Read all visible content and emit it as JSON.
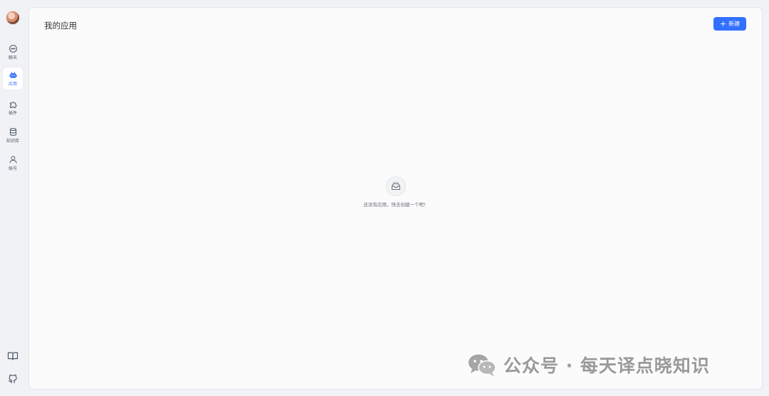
{
  "sidebar": {
    "items": [
      {
        "label": "聊天",
        "icon": "chat-icon"
      },
      {
        "label": "应用",
        "icon": "robot-icon",
        "active": true
      },
      {
        "label": "插件",
        "icon": "puzzle-icon"
      },
      {
        "label": "知识库",
        "icon": "database-icon"
      },
      {
        "label": "账号",
        "icon": "user-icon"
      }
    ],
    "bottom": [
      {
        "icon": "book-icon"
      },
      {
        "icon": "github-icon"
      }
    ]
  },
  "main": {
    "title": "我的应用",
    "new_button_label": "新建",
    "empty_text": "还没有应用，快去创建一个吧！",
    "empty_icon": "empty-box-icon"
  },
  "watermark": {
    "text": "公众号 · 每天译点晓知识",
    "icon": "wechat-icon"
  },
  "colors": {
    "accent": "#3370ff",
    "background": "#f1f2f5",
    "panel": "#fbfbfc"
  }
}
